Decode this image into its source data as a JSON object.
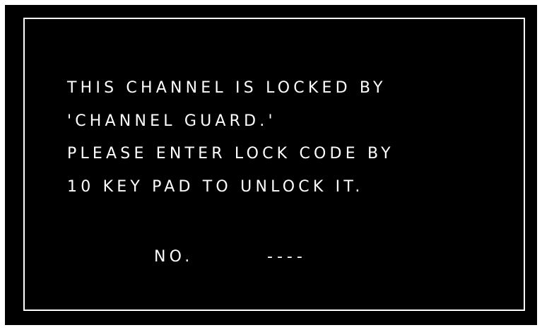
{
  "message": {
    "line1": "THIS CHANNEL IS LOCKED BY",
    "line2": "'CHANNEL GUARD.'",
    "line3": "PLEASE ENTER LOCK CODE BY",
    "line4": "10 KEY PAD TO UNLOCK IT."
  },
  "lock_code": {
    "label": "NO.",
    "value": "----"
  },
  "colors": {
    "background": "#000000",
    "foreground": "#ffffff"
  }
}
